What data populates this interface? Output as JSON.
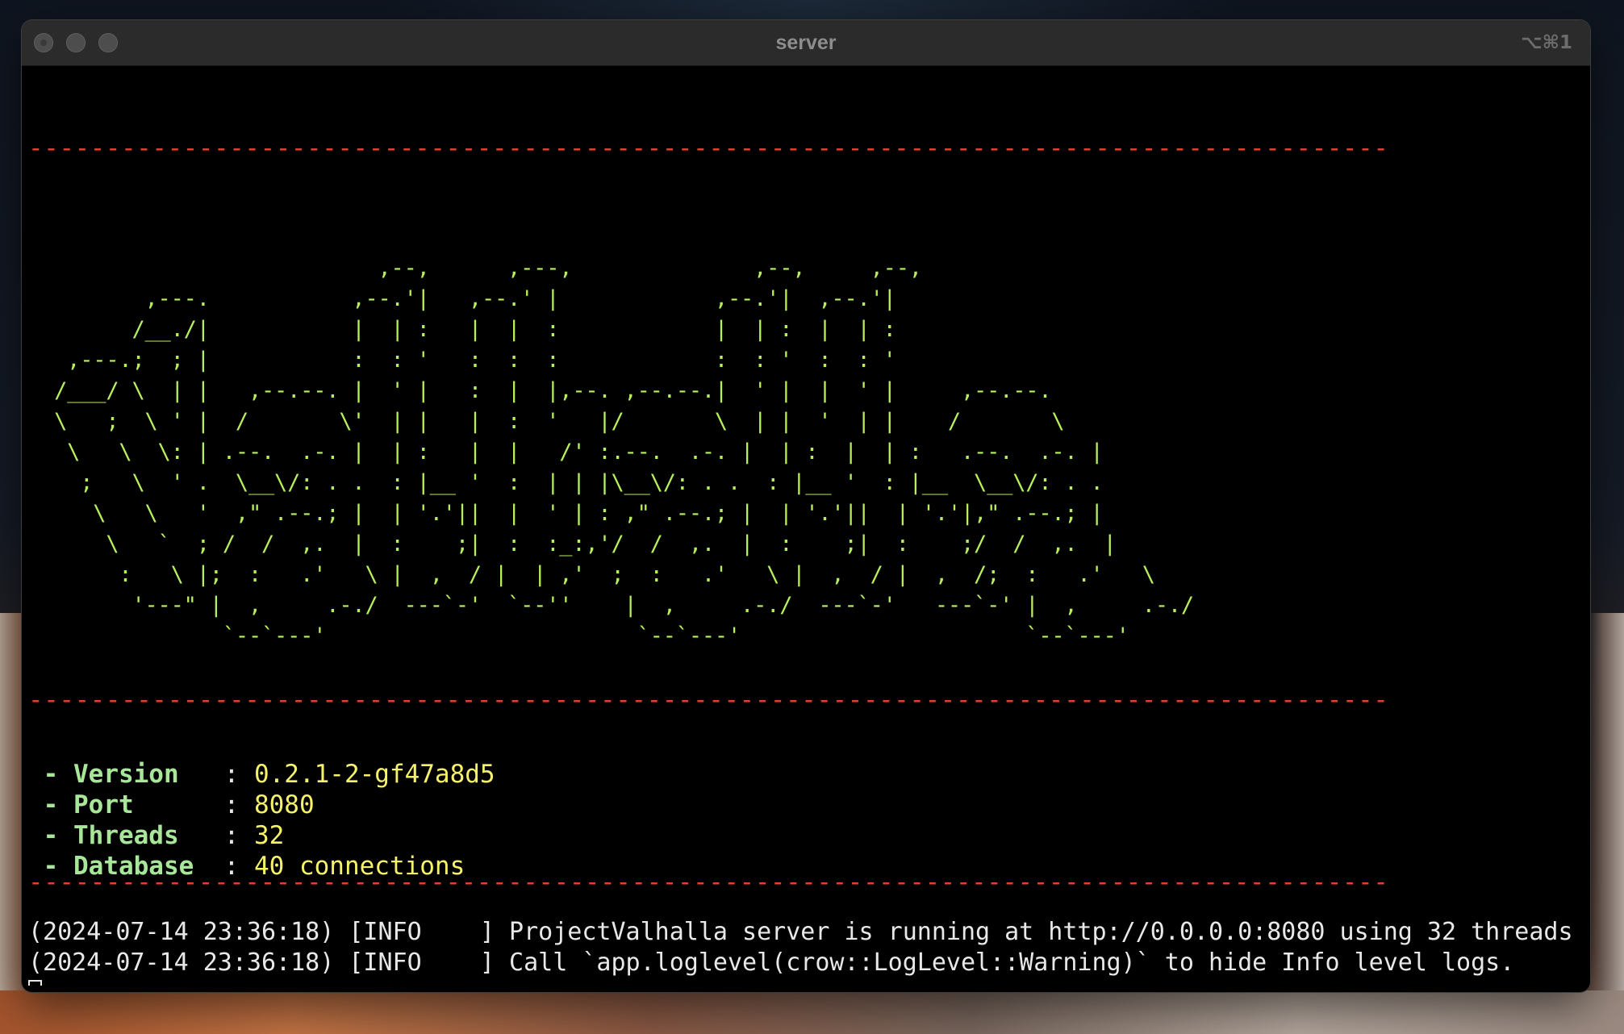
{
  "window": {
    "title": "server",
    "shortcut": "⌥⌘1"
  },
  "terminal": {
    "rule": "----------------------------------------------------------------------------------------",
    "banner_art": "                           ,--,      ,---,              ,--,     ,--,\n         ,---.           ,--.'|   ,--.' |            ,--.'|  ,--.'|\n        /__./|           |  | :   |  |  :            |  | :  |  | :\n   ,---.;  ; |           :  : '   :  :  :            :  : '  :  : '\n  /___/ \\  | |   ,--.--. |  ' |   :  |  |,--. ,--.--.|  ' |  |  ' |     ,--.--.\n  \\   ;  \\ ' |  /       \\'  | |   |  :  '   |/       \\  | |  '  | |    /       \\\n   \\   \\  \\: | .--.  .-. |  | :   |  |   /' :.--.  .-. |  | :  |  | :   .--.  .-. |\n    ;   \\  ' .  \\__\\/: . .  : |__ '  :  | | |\\__\\/: . .  : |__ '  : |__  \\__\\/: . .\n     \\   \\   '  ,\" .--.; |  | '.'||  |  ' | : ,\" .--.; |  | '.'||  | '.'|,\" .--.; |\n      \\   `  ; /  /  ,.  |  :    ;|  :  :_:,'/  /  ,.  |  :    ;|  :    ;/  /  ,.  |\n       :   \\ |;  :   .'   \\ |  ,  / |  | ,'  ;  :   .'   \\ |  ,  / |  ,  /;  :   .'   \\\n        '---\" |  ,     .-./  ---`-'  `--''    |  ,     .-./  ---`-'   ---`-' |  ,     .-./\n               `--`---'                        `--`---'                      `--`---'",
    "info": [
      {
        "label": " - Version  ",
        "sep": " : ",
        "value": "0.2.1-2-gf47a8d5"
      },
      {
        "label": " - Port     ",
        "sep": " : ",
        "value": "8080"
      },
      {
        "label": " - Threads  ",
        "sep": " : ",
        "value": "32"
      },
      {
        "label": " - Database ",
        "sep": " : ",
        "value": "40 connections"
      }
    ],
    "logs": [
      "(2024-07-14 23:36:18) [INFO    ] ProjectValhalla server is running at http://0.0.0.0:8080 using 32 threads",
      "(2024-07-14 23:36:18) [INFO    ] Call `app.loglevel(crow::LogLevel::Warning)` to hide Info level logs."
    ]
  },
  "colors": {
    "rule": "#e0412f",
    "banner": "#b7f05c",
    "label": "#a8e69a",
    "value": "#f5f16a",
    "background": "#000000"
  }
}
